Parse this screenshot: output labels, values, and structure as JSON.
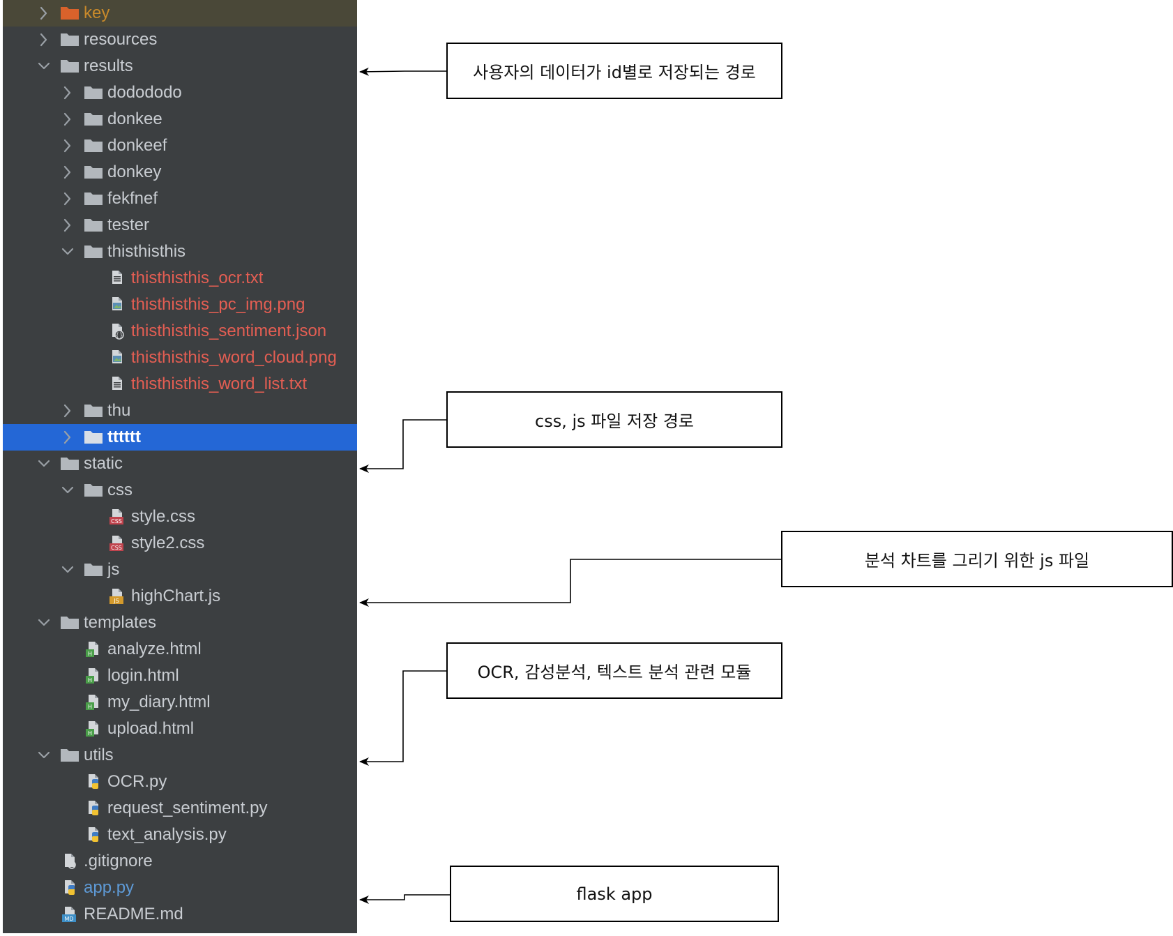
{
  "tree": {
    "rows": [
      {
        "label": "key",
        "level": 0,
        "kind": "folder",
        "chevron": "right",
        "color": "orange",
        "highlight": true
      },
      {
        "label": "resources",
        "level": 0,
        "kind": "folder",
        "chevron": "right"
      },
      {
        "label": "results",
        "level": 0,
        "kind": "folder",
        "chevron": "down"
      },
      {
        "label": "dodododo",
        "level": 1,
        "kind": "folder",
        "chevron": "right"
      },
      {
        "label": "donkee",
        "level": 1,
        "kind": "folder",
        "chevron": "right"
      },
      {
        "label": "donkeef",
        "level": 1,
        "kind": "folder",
        "chevron": "right"
      },
      {
        "label": "donkey",
        "level": 1,
        "kind": "folder",
        "chevron": "right"
      },
      {
        "label": "fekfnef",
        "level": 1,
        "kind": "folder",
        "chevron": "right"
      },
      {
        "label": "tester",
        "level": 1,
        "kind": "folder",
        "chevron": "right"
      },
      {
        "label": "thisthisthis",
        "level": 1,
        "kind": "folder",
        "chevron": "down"
      },
      {
        "label": "thisthisthis_ocr.txt",
        "level": 2,
        "kind": "txt",
        "color": "red"
      },
      {
        "label": "thisthisthis_pc_img.png",
        "level": 2,
        "kind": "img",
        "color": "red"
      },
      {
        "label": "thisthisthis_sentiment.json",
        "level": 2,
        "kind": "json",
        "color": "red"
      },
      {
        "label": "thisthisthis_word_cloud.png",
        "level": 2,
        "kind": "img",
        "color": "red"
      },
      {
        "label": "thisthisthis_word_list.txt",
        "level": 2,
        "kind": "txt",
        "color": "red"
      },
      {
        "label": "thu",
        "level": 1,
        "kind": "folder",
        "chevron": "right"
      },
      {
        "label": "tttttt",
        "level": 1,
        "kind": "folder",
        "chevron": "right",
        "selected": true
      },
      {
        "label": "static",
        "level": 0,
        "kind": "folder",
        "chevron": "down"
      },
      {
        "label": "css",
        "level": 1,
        "kind": "folder",
        "chevron": "down"
      },
      {
        "label": "style.css",
        "level": 2,
        "kind": "css"
      },
      {
        "label": "style2.css",
        "level": 2,
        "kind": "css"
      },
      {
        "label": "js",
        "level": 1,
        "kind": "folder",
        "chevron": "down"
      },
      {
        "label": "highChart.js",
        "level": 2,
        "kind": "js"
      },
      {
        "label": "templates",
        "level": 0,
        "kind": "folder",
        "chevron": "down"
      },
      {
        "label": "analyze.html",
        "level": 1,
        "kind": "html"
      },
      {
        "label": "login.html",
        "level": 1,
        "kind": "html"
      },
      {
        "label": "my_diary.html",
        "level": 1,
        "kind": "html"
      },
      {
        "label": "upload.html",
        "level": 1,
        "kind": "html"
      },
      {
        "label": "utils",
        "level": 0,
        "kind": "folder",
        "chevron": "down"
      },
      {
        "label": "OCR.py",
        "level": 1,
        "kind": "py"
      },
      {
        "label": "request_sentiment.py",
        "level": 1,
        "kind": "py"
      },
      {
        "label": "text_analysis.py",
        "level": 1,
        "kind": "py"
      },
      {
        "label": ".gitignore",
        "level": 0,
        "kind": "ignore"
      },
      {
        "label": "app.py",
        "level": 0,
        "kind": "py",
        "color": "blue"
      },
      {
        "label": "README.md",
        "level": 0,
        "kind": "md"
      }
    ]
  },
  "callouts": [
    {
      "text": "사용자의 데이터가 id별로 저장되는 경로",
      "points_to": "results"
    },
    {
      "text": "css, js 파일 저장 경로",
      "points_to": "static"
    },
    {
      "text": "분석 차트를 그리기 위한 js 파일",
      "points_to": "highChart.js"
    },
    {
      "text": "OCR, 감성분석, 텍스트 분석 관련 모듈",
      "points_to": "utils"
    },
    {
      "text": "flask app",
      "points_to": "app.py"
    }
  ],
  "icon_badges": {
    "css": "CSS",
    "js": "JS",
    "html": "H",
    "md": "MD"
  },
  "colors": {
    "panel": "#3c3f41",
    "folder": "#b3b8bd",
    "text": "#c9cdd2",
    "red": "#e45e53",
    "blue": "#5e9ad6",
    "orange": "#c98a2b",
    "selection": "#2467d6"
  }
}
